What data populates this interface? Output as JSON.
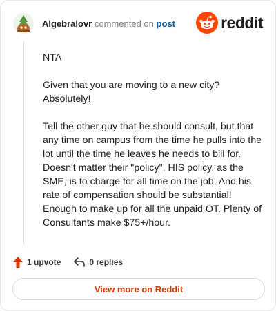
{
  "comment": {
    "username": "Algebralovr",
    "action_text": "commented on",
    "target_link": "post"
  },
  "brand": {
    "wordmark": "reddit",
    "logo_icon": "reddit-snoo-icon",
    "accent_color": "#FF4500"
  },
  "body": {
    "paragraphs": [
      "NTA",
      "Given that you are moving to a new city? Absolutely!",
      "Tell the other guy that he should consult, but that any time on campus from the time he pulls into the lot until the time he leaves he needs to bill for. Doesn't matter their \"policy\", HIS policy, as the SME, is to charge for all time on the job. And his rate of compensation should be substantial! Enough to make up for all the unpaid OT. Plenty of Consultants make $75+/hour."
    ]
  },
  "actions": {
    "upvote_label": "1 upvote",
    "upvote_icon": "upvote-arrow-icon",
    "upvote_color": "#D93A00",
    "replies_label": "0 replies",
    "replies_icon": "reply-arrow-icon"
  },
  "footer": {
    "view_more_label": "View more on Reddit",
    "view_more_color": "#D93A00"
  }
}
